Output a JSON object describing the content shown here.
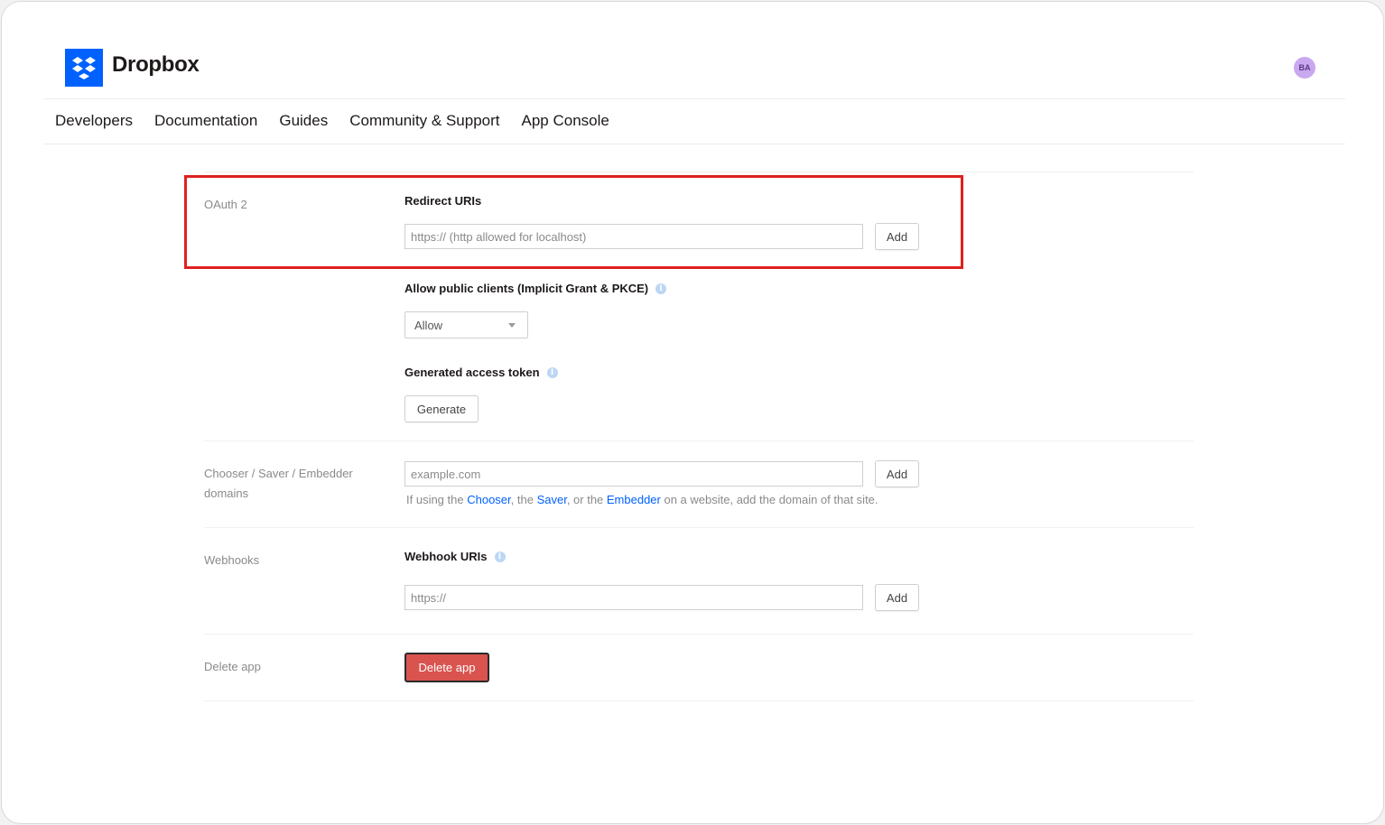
{
  "brand": {
    "name": "Dropbox",
    "logo_color": "#0061fe",
    "avatar_initials": "BA",
    "avatar_color": "#c9a8f0"
  },
  "nav": {
    "items": [
      {
        "label": "Developers"
      },
      {
        "label": "Documentation"
      },
      {
        "label": "Guides"
      },
      {
        "label": "Community & Support"
      },
      {
        "label": "App Console"
      }
    ]
  },
  "oauth": {
    "section_label": "OAuth 2",
    "redirect": {
      "title": "Redirect URIs",
      "placeholder": "https:// (http allowed for localhost)",
      "value": "",
      "add_label": "Add"
    },
    "public_clients": {
      "title": "Allow public clients (Implicit Grant & PKCE)",
      "selected": "Allow"
    },
    "access_token": {
      "title": "Generated access token",
      "button_label": "Generate"
    }
  },
  "domains": {
    "section_label": "Chooser / Saver / Embedder domains",
    "placeholder": "example.com",
    "value": "",
    "add_label": "Add",
    "help": {
      "prefix": "If using the ",
      "chooser": "Chooser",
      "sep1": ", the ",
      "saver": "Saver",
      "sep2": ", or the ",
      "embedder": "Embedder",
      "suffix": " on a website, add the domain of that site."
    }
  },
  "webhooks": {
    "section_label": "Webhooks",
    "title": "Webhook URIs",
    "placeholder": "https://",
    "value": "",
    "add_label": "Add"
  },
  "delete": {
    "section_label": "Delete app",
    "button_label": "Delete app",
    "button_color": "#d9534f"
  },
  "highlight_color": "#e02020",
  "info_icon": "info-icon"
}
